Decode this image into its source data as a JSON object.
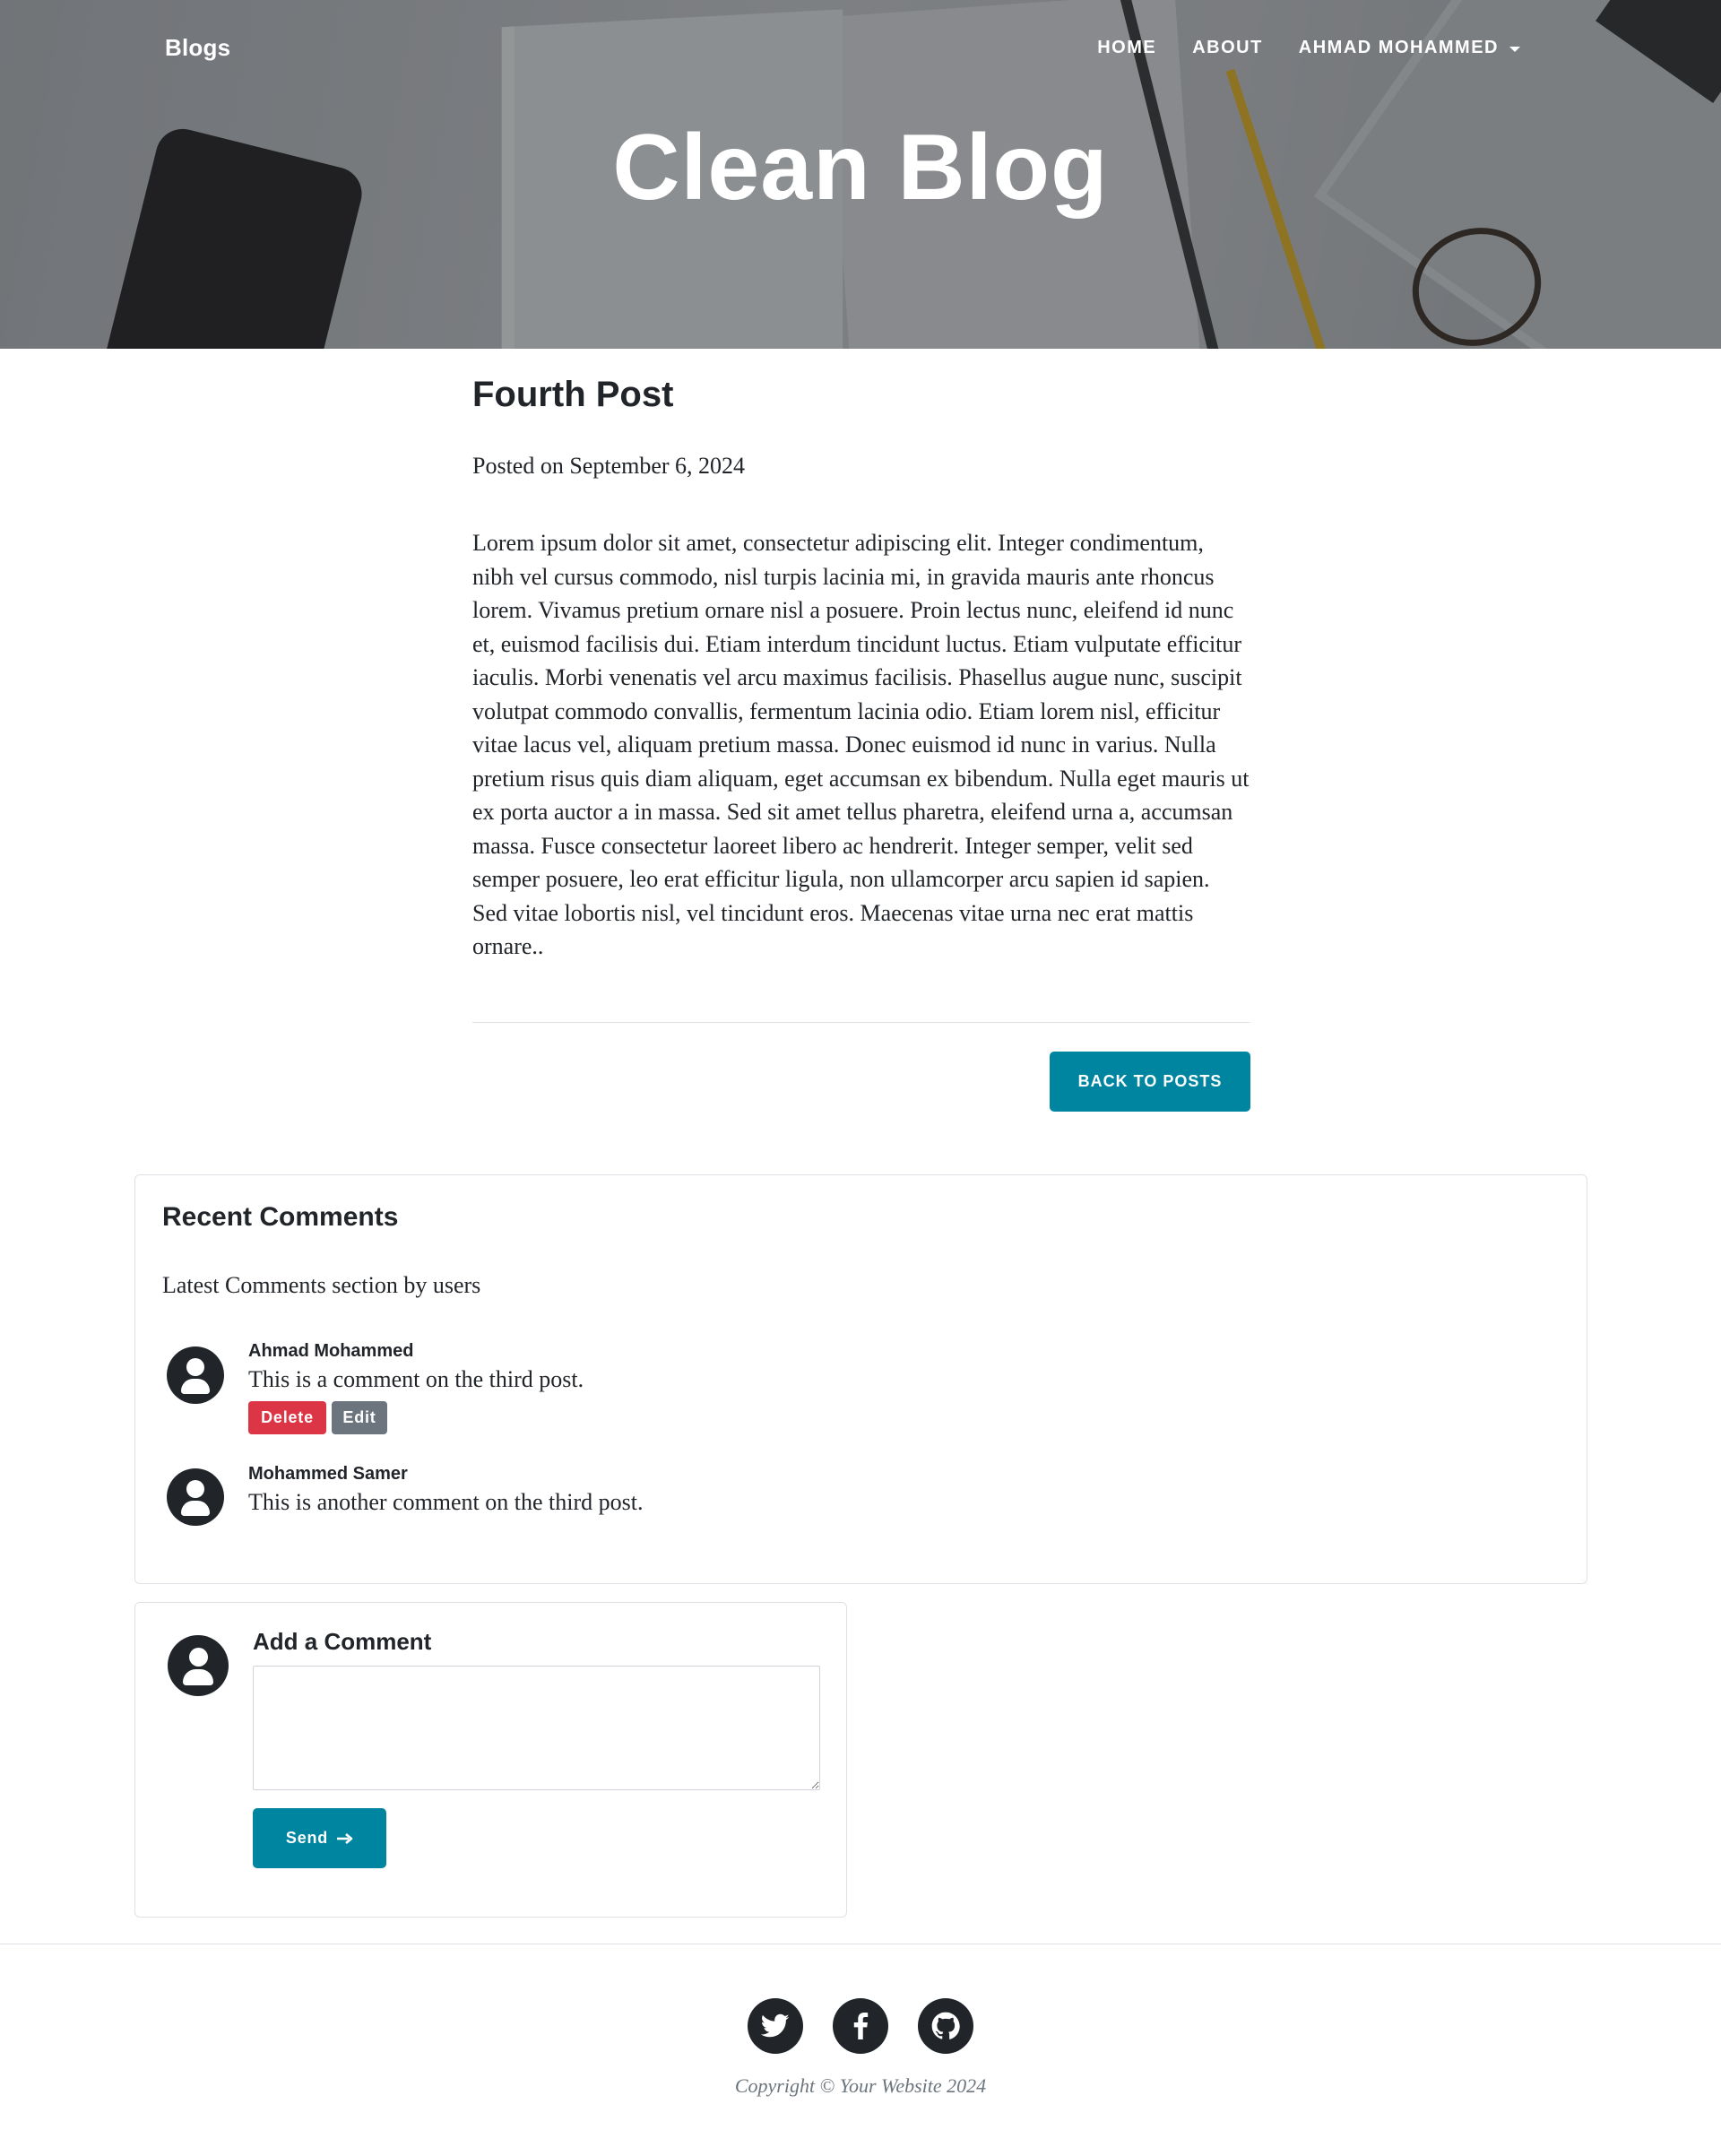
{
  "navbar": {
    "brand": "Blogs",
    "links": [
      {
        "label": "HOME"
      },
      {
        "label": "ABOUT"
      },
      {
        "label": "AHMAD MOHAMMED"
      }
    ]
  },
  "hero": {
    "title": "Clean Blog"
  },
  "post": {
    "title": "Fourth Post",
    "meta": "Posted on September 6, 2024",
    "body": "Lorem ipsum dolor sit amet, consectetur adipiscing elit. Integer condimentum, nibh vel cursus commodo, nisl turpis lacinia mi, in gravida mauris ante rhoncus lorem. Vivamus pretium ornare nisl a posuere. Proin lectus nunc, eleifend id nunc et, euismod facilisis dui. Etiam interdum tincidunt luctus. Etiam vulputate efficitur iaculis. Morbi venenatis vel arcu maximus facilisis. Phasellus augue nunc, suscipit volutpat commodo convallis, fermentum lacinia odio. Etiam lorem nisl, efficitur vitae lacus vel, aliquam pretium massa. Donec euismod id nunc in varius. Nulla pretium risus quis diam aliquam, eget accumsan ex bibendum. Nulla eget mauris ut ex porta auctor a in massa. Sed sit amet tellus pharetra, eleifend urna a, accumsan massa. Fusce consectetur laoreet libero ac hendrerit. Integer semper, velit sed semper posuere, leo erat efficitur ligula, non ullamcorper arcu sapien id sapien. Sed vitae lobortis nisl, vel tincidunt eros. Maecenas vitae urna nec erat mattis ornare..",
    "back_label": "BACK TO POSTS"
  },
  "comments": {
    "title": "Recent Comments",
    "subtitle": "Latest Comments section by users",
    "items": [
      {
        "author": "Ahmad Mohammed",
        "text": "This is a comment on the third post.",
        "delete_label": "Delete",
        "edit_label": "Edit"
      },
      {
        "author": "Mohammed Samer",
        "text": "This is another comment on the third post."
      }
    ]
  },
  "add_comment": {
    "title": "Add a Comment",
    "textarea_value": "",
    "send_label": "Send"
  },
  "footer": {
    "social_icons": [
      "twitter-icon",
      "facebook-icon",
      "github-icon"
    ],
    "copyright": "Copyright © Your Website 2024"
  },
  "colors": {
    "accent": "#0085a1",
    "danger": "#dc3545",
    "secondary": "#6c757d",
    "dark": "#212529"
  }
}
